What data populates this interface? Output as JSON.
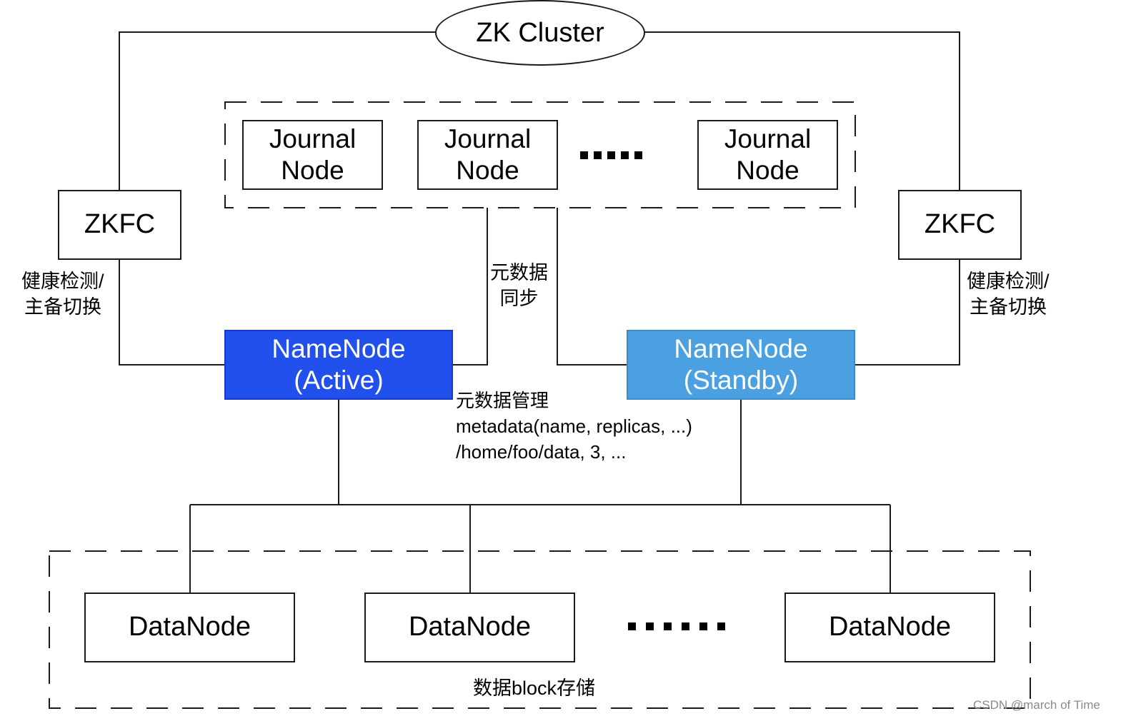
{
  "diagram": {
    "zk_cluster": {
      "label": "ZK Cluster"
    },
    "journal_nodes": [
      {
        "line1": "Journal",
        "line2": "Node"
      },
      {
        "line1": "Journal",
        "line2": "Node"
      },
      {
        "line1": "Journal",
        "line2": "Node"
      }
    ],
    "zkfc": [
      {
        "label": "ZKFC"
      },
      {
        "label": "ZKFC"
      }
    ],
    "zkfc_labels": [
      {
        "line1": "健康检测/",
        "line2": "主备切换"
      },
      {
        "line1": "健康检测/",
        "line2": "主备切换"
      }
    ],
    "sync_label": {
      "line1": "元数据",
      "line2": "同步"
    },
    "namenodes": [
      {
        "line1": "NameNode",
        "line2": "(Active)",
        "color": "#2250ec"
      },
      {
        "line1": "NameNode",
        "line2": "(Standby)",
        "color": "#4aa0e0"
      }
    ],
    "metadata_note": {
      "line1": "元数据管理",
      "line2": "metadata(name, replicas, ...)",
      "line3": "/home/foo/data, 3, ..."
    },
    "datanodes": [
      {
        "label": "DataNode"
      },
      {
        "label": "DataNode"
      },
      {
        "label": "DataNode"
      }
    ],
    "storage_label": "数据block存储",
    "ellipsis_journal": "·····",
    "ellipsis_data": "······"
  },
  "watermark": "CSDN @march of Time"
}
